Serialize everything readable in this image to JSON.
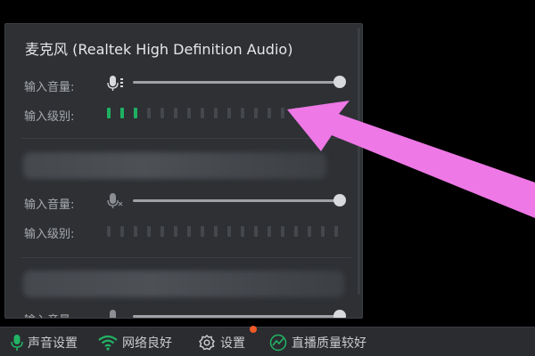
{
  "device_title": "麦克风 (Realtek High Definition Audio)",
  "sections": [
    {
      "volume_label": "输入音量:",
      "level_label": "输入级别:",
      "volume_fraction": 1.0,
      "level_active_segments": 3,
      "level_total_segments": 15
    },
    {
      "volume_label": "输入音量:",
      "level_label": "输入级别:",
      "volume_fraction": 1.0,
      "level_active_segments": 0,
      "level_total_segments": 18
    },
    {
      "volume_label": "输入音量:",
      "volume_fraction": 1.0
    }
  ],
  "taskbar": {
    "sound_settings": "声音设置",
    "network": "网络良好",
    "settings": "设置",
    "stream_quality": "直播质量较好"
  },
  "colors": {
    "panel_bg": "#2e3034",
    "level_active": "#1fb061",
    "level_inactive": "#44474c",
    "network_green": "#22b464",
    "notification_dot": "#f05a28",
    "annotation_arrow": "#ee78e6"
  }
}
